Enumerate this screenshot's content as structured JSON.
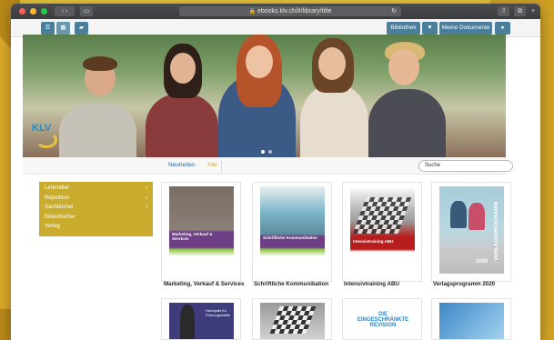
{
  "browser": {
    "url": "ebooks.klv.ch/#/library/title"
  },
  "toolbar": {
    "library_label": "Bibliothek",
    "documents_label": "Meine Dokumente"
  },
  "hero": {
    "logo_text": "KLV"
  },
  "filter": {
    "new_label": "Neuheiten",
    "all_label": "Alle",
    "search_placeholder": "Suche"
  },
  "sidebar": {
    "items": [
      {
        "label": "Lehrmittel",
        "has_children": true
      },
      {
        "label": "Repetition",
        "has_children": true
      },
      {
        "label": "Sachbücher",
        "has_children": true
      },
      {
        "label": "Bilderbücher",
        "has_children": false
      },
      {
        "label": "Verlag",
        "has_children": false
      }
    ]
  },
  "books": [
    {
      "title": "Marketing, Verkauf & Services",
      "cover_text": "Marketing, Verkauf & Services"
    },
    {
      "title": "Schriftliche Kommunikation",
      "cover_text": "Schriftliche Kommunikation"
    },
    {
      "title": "Intensivtraining ABU",
      "cover_text": "Intensivtraining ABU"
    },
    {
      "title": "Verlagsprogramm 2020",
      "cover_text": "VERLAGSPROGRAMM",
      "cover_year": "2020"
    }
  ],
  "books_row2": [
    {
      "cover_text": "Handpakt für Führungskräfte"
    },
    {
      "cover_text": ""
    },
    {
      "cover_text": "DIE EINGESCHRÄNKTE REVISION"
    },
    {
      "cover_text": ""
    }
  ],
  "colors": {
    "accent_gold": "#c9ab2e",
    "toolbar_blue": "#4b7e9a",
    "link_blue": "#2b6aa8"
  }
}
